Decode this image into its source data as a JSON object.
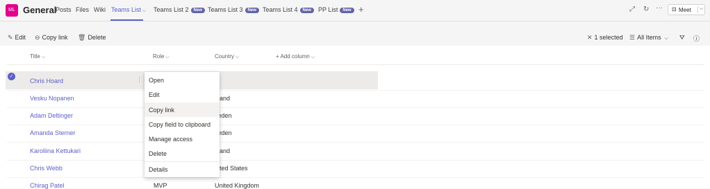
{
  "header": {
    "team_initials": "ML",
    "channel": "General",
    "tabs": [
      {
        "label": "Posts"
      },
      {
        "label": "Files"
      },
      {
        "label": "Wiki"
      },
      {
        "label": "Teams List",
        "chevron": "⌵"
      },
      {
        "label": "Teams List 2",
        "badge": "New"
      },
      {
        "label": "Teams List 3",
        "badge": "New"
      },
      {
        "label": "Teams List 4",
        "badge": "New"
      },
      {
        "label": "PP List",
        "badge": "New"
      }
    ],
    "add_tab": "+",
    "meet_label": "Meet"
  },
  "commandbar": {
    "edit": "Edit",
    "copy_link": "Copy link",
    "delete": "Delete",
    "selected": "1 selected",
    "view": "All Items"
  },
  "list": {
    "columns": [
      "Title",
      "Role",
      "Country",
      "Add column"
    ],
    "rows": [
      {
        "title": "Chris Hoard",
        "role": "",
        "country": "K"
      },
      {
        "title": "Vesku Nopanen",
        "role": "",
        "country": "nland"
      },
      {
        "title": "Adam Deltinger",
        "role": "",
        "country": "veden"
      },
      {
        "title": "Amanda Sterner",
        "role": "",
        "country": "veden"
      },
      {
        "title": "Karoliina Kettukari",
        "role": "",
        "country": "nland"
      },
      {
        "title": "Chris Webb",
        "role": "",
        "country": "nited States"
      },
      {
        "title": "Chirag Patel",
        "role": "MVP",
        "country": "United Kingdom"
      }
    ]
  },
  "context_menu": {
    "items": [
      "Open",
      "Edit",
      "Copy link",
      "Copy field to clipboard",
      "Manage access",
      "Delete",
      "Details"
    ]
  },
  "colors": {
    "accent": "#5b5fc7",
    "team_avatar": "#e3008c",
    "badge": "#6264a7"
  }
}
